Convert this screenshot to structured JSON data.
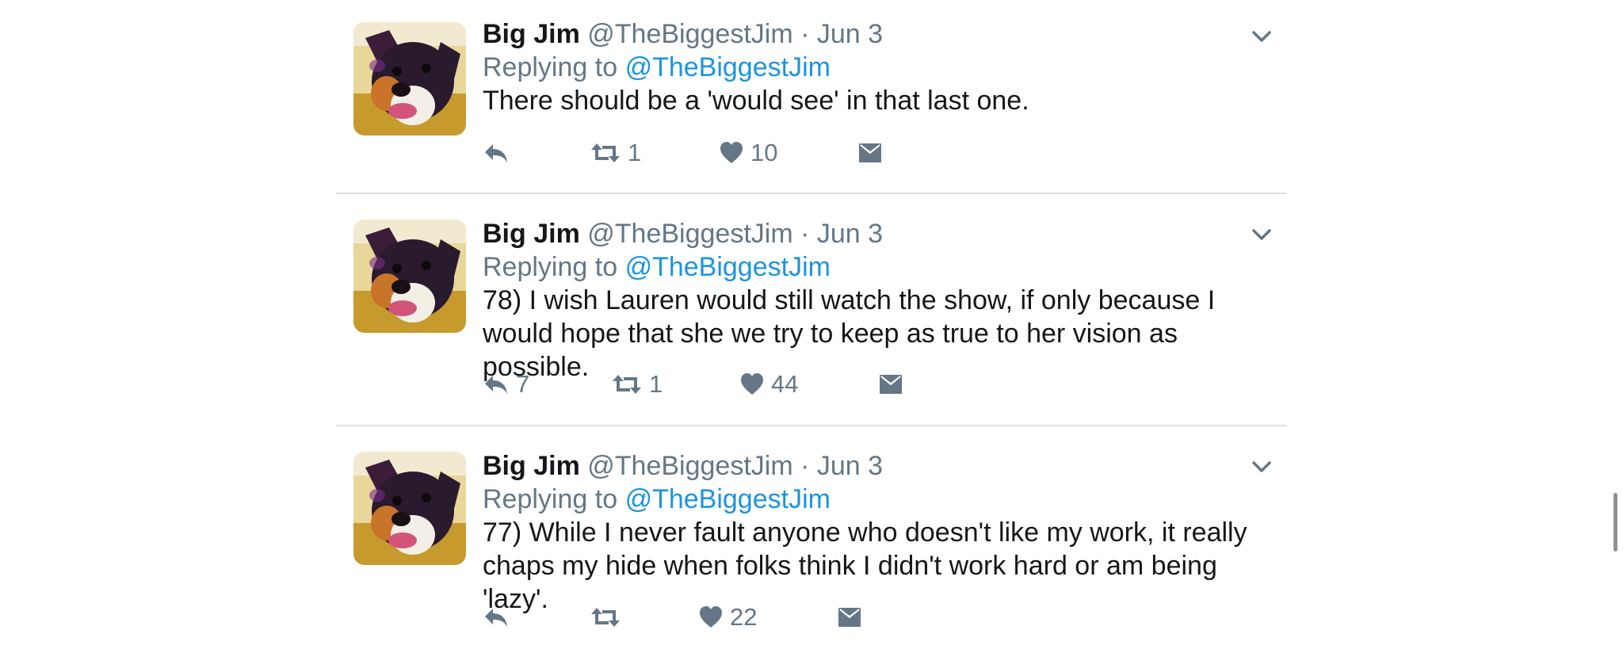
{
  "colors": {
    "text": "#14171a",
    "secondary": "#657786",
    "link": "#1b95e0",
    "divider": "#dcdfe3"
  },
  "tweets": [
    {
      "author": "Big Jim",
      "handle": "@TheBiggestJim",
      "separator": "·",
      "date": "Jun 3",
      "replying_prefix": "Replying to",
      "replying_handle": "@TheBiggestJim",
      "text": "There should be a 'would see' in that last one.",
      "replies": "",
      "retweets": "1",
      "likes": "10"
    },
    {
      "author": "Big Jim",
      "handle": "@TheBiggestJim",
      "separator": "·",
      "date": "Jun 3",
      "replying_prefix": "Replying to",
      "replying_handle": "@TheBiggestJim",
      "text": "78) I wish Lauren would still watch the show, if only because I would hope that she we try to keep as true to her vision as possible.",
      "replies": "7",
      "retweets": "1",
      "likes": "44"
    },
    {
      "author": "Big Jim",
      "handle": "@TheBiggestJim",
      "separator": "·",
      "date": "Jun 3",
      "replying_prefix": "Replying to",
      "replying_handle": "@TheBiggestJim",
      "text": "77) While I never fault anyone who doesn't like my work, it really chaps my hide when folks think I didn't work hard or am being 'lazy'.",
      "replies": "",
      "retweets": "",
      "likes": "22"
    }
  ],
  "icons": {
    "reply": "reply-arrow-icon",
    "retweet": "retweet-icon",
    "like": "heart-icon",
    "dm": "envelope-icon",
    "more": "chevron-down-icon"
  }
}
